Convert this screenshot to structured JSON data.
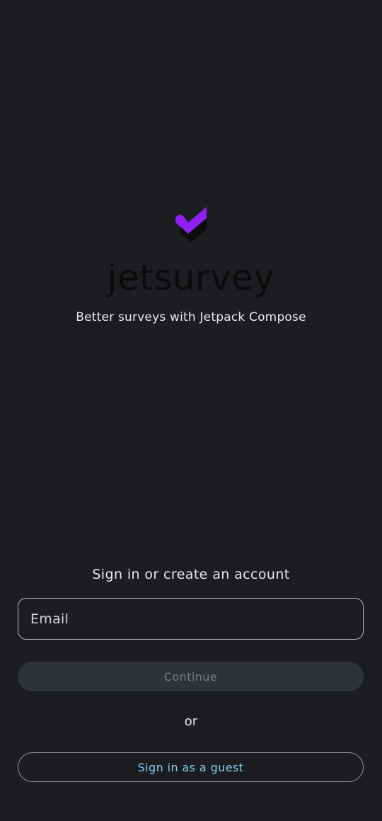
{
  "brand": {
    "name": "jetsurvey",
    "tagline": "Better surveys with Jetpack Compose",
    "logo_icon": "jetsurvey-check-heart-icon",
    "accent_color": "#8f1ff2"
  },
  "auth": {
    "heading": "Sign in or create an account",
    "email_placeholder": "Email",
    "email_value": "",
    "continue_label": "Continue",
    "continue_enabled": false,
    "divider_label": "or",
    "guest_label": "Sign in as a guest",
    "guest_color": "#86c9f5"
  }
}
